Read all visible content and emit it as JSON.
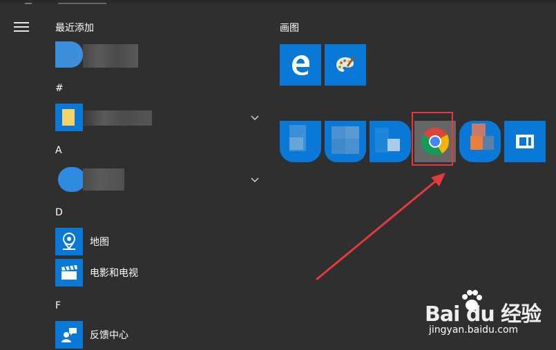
{
  "start_menu": {
    "recent_header": "最近添加",
    "groups": [
      {
        "letter": "#"
      },
      {
        "letter": "A"
      },
      {
        "letter": "D",
        "apps": [
          "地图",
          "电影和电视"
        ]
      },
      {
        "letter": "F",
        "apps": [
          "反馈中心"
        ]
      }
    ]
  },
  "tiles": {
    "group_title": "画图",
    "items": [
      "edge-tile",
      "paint-tile",
      "blurred-tile-1",
      "blurred-tile-2",
      "blurred-tile-3",
      "chrome-tile",
      "blurred-tile-4",
      "window-tile"
    ]
  },
  "watermark": {
    "brand": "Bai du 经验",
    "url": "jingyan.baidu.com"
  },
  "colors": {
    "tile_blue": "#0a78d7",
    "background": "#2f2f2f",
    "annotation_red": "#e53a3a"
  }
}
